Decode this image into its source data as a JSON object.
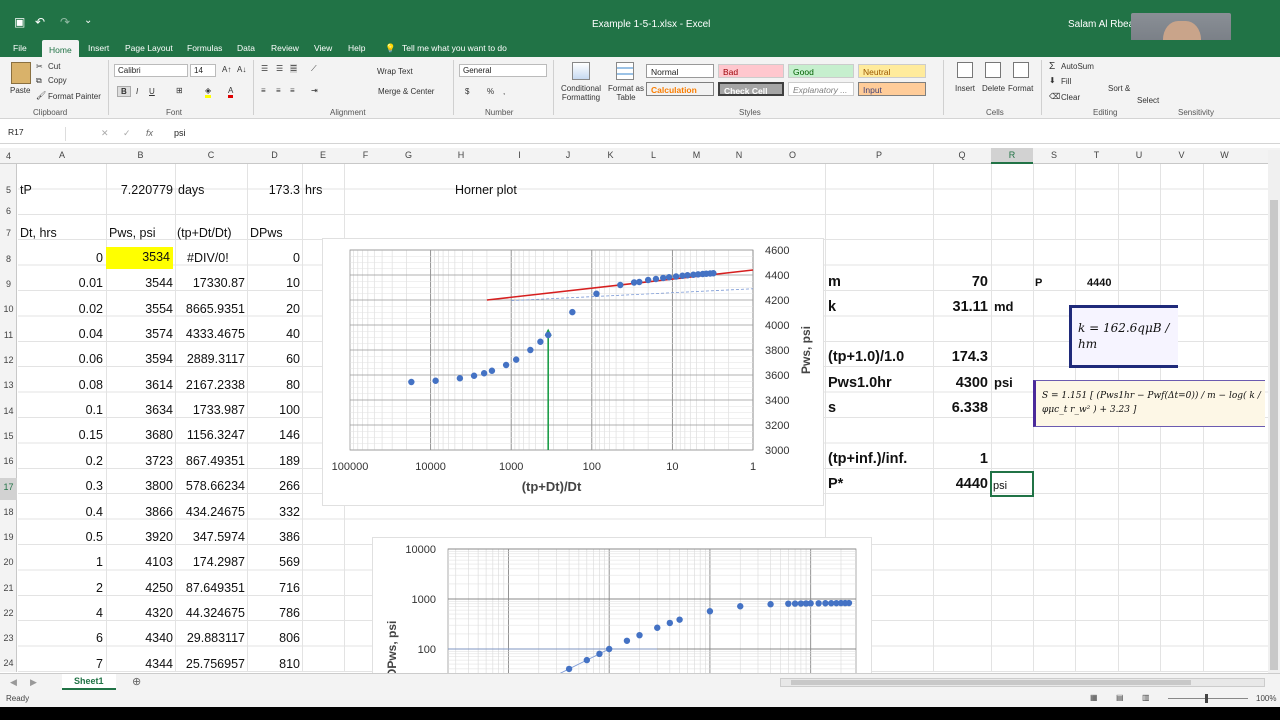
{
  "window": {
    "title": "Example 1-5-1.xlsx  -  Excel",
    "user": "Salam Al Rbeawi"
  },
  "menu": [
    "File",
    "Home",
    "Insert",
    "Page Layout",
    "Formulas",
    "Data",
    "Review",
    "View",
    "Help",
    "Tell me what you want to do"
  ],
  "ribbon": {
    "clipboard": {
      "paste": "Paste",
      "cut": "Cut",
      "copy": "Copy",
      "painter": "Format Painter",
      "label": "Clipboard"
    },
    "font": {
      "name": "Calibri",
      "size": "14",
      "label": "Font",
      "b": "B",
      "i": "I",
      "u": "U"
    },
    "alignment": {
      "wrap": "Wrap Text",
      "merge": "Merge & Center",
      "label": "Alignment"
    },
    "number": {
      "format": "General",
      "label": "Number",
      "currency": "$",
      "percent": "%",
      "comma": ","
    },
    "styles": {
      "cond": "Conditional Formatting",
      "table": "Format as Table",
      "normal": "Normal",
      "bad": "Bad",
      "good": "Good",
      "neutral": "Neutral",
      "calc": "Calculation",
      "check": "Check Cell",
      "expl": "Explanatory ...",
      "input": "Input",
      "label": "Styles"
    },
    "cells": {
      "insert": "Insert",
      "delete": "Delete",
      "format": "Format",
      "label": "Cells"
    },
    "editing": {
      "autosum": "AutoSum",
      "fill": "Fill",
      "clear": "Clear",
      "sort": "Sort & Filter",
      "find": "Select",
      "label": "Editing"
    },
    "sensitivity": "Sensitivity"
  },
  "formula": {
    "namebox": "R17",
    "fx": "fx",
    "content": "psi"
  },
  "columns": [
    "A",
    "B",
    "C",
    "D",
    "E",
    "F",
    "G",
    "H",
    "I",
    "J",
    "K",
    "L",
    "M",
    "N",
    "O",
    "P",
    "Q",
    "R",
    "S",
    "T",
    "U",
    "V",
    "W"
  ],
  "rows": [
    "4",
    "5",
    "6",
    "7",
    "8",
    "9",
    "10",
    "11",
    "12",
    "13",
    "14",
    "15",
    "16",
    "17",
    "18",
    "19",
    "20",
    "21",
    "22",
    "23",
    "24"
  ],
  "cells": {
    "tp_label": "tP",
    "tp_val": "7.220779",
    "tp_days": "days",
    "tp_hrs_val": "173.3",
    "tp_hrs": "hrs",
    "horner_title": "Horner plot",
    "h_dt": "Dt, hrs",
    "h_pws": "Pws, psi",
    "h_ratio": "(tp+Dt/Dt)",
    "h_dpws": "DPws"
  },
  "table": [
    [
      "0",
      "3534",
      "#DIV/0!",
      "0"
    ],
    [
      "0.01",
      "3544",
      "17330.87",
      "10"
    ],
    [
      "0.02",
      "3554",
      "8665.9351",
      "20"
    ],
    [
      "0.04",
      "3574",
      "4333.4675",
      "40"
    ],
    [
      "0.06",
      "3594",
      "2889.3117",
      "60"
    ],
    [
      "0.08",
      "3614",
      "2167.2338",
      "80"
    ],
    [
      "0.1",
      "3634",
      "1733.987",
      "100"
    ],
    [
      "0.15",
      "3680",
      "1156.3247",
      "146"
    ],
    [
      "0.2",
      "3723",
      "867.49351",
      "189"
    ],
    [
      "0.3",
      "3800",
      "578.66234",
      "266"
    ],
    [
      "0.4",
      "3866",
      "434.24675",
      "332"
    ],
    [
      "0.5",
      "3920",
      "347.5974",
      "386"
    ],
    [
      "1",
      "4103",
      "174.2987",
      "569"
    ],
    [
      "2",
      "4250",
      "87.649351",
      "716"
    ],
    [
      "4",
      "4320",
      "44.324675",
      "786"
    ],
    [
      "6",
      "4340",
      "29.883117",
      "806"
    ],
    [
      "7",
      "4344",
      "25.756957",
      "810"
    ]
  ],
  "results": {
    "m_label": "m",
    "m_val": "70",
    "k_label": "k",
    "k_val": "31.11",
    "k_unit": "md",
    "tp1_label": "(tp+1.0)/1.0",
    "tp1_val": "174.3",
    "pws1_label": "Pws1.0hr",
    "pws1_val": "4300",
    "pws1_unit": "psi",
    "s_label": "s",
    "s_val": "6.338",
    "tpinf_label": "(tp+inf.)/inf.",
    "tpinf_val": "1",
    "pstar_label": "P*",
    "pstar_val": "4440",
    "pstar_unit": "psi",
    "p_label": "P",
    "p_val": "4440"
  },
  "equations": {
    "k_eq": "k = 162.6qμB / hm",
    "s_eq": "S = 1.151 [ (Pws1hr − Pwf(Δt=0)) / m − log( k / φμc_t r_w² ) + 3.23 ]"
  },
  "chart_data": [
    {
      "type": "scatter",
      "xlabel": "(tp+Dt)/Dt",
      "ylabel": "Pws, psi",
      "xscale": "log",
      "xreversed": true,
      "xlim": [
        100000,
        1
      ],
      "ylim": [
        3000,
        4600
      ],
      "xticks": [
        "100000",
        "10000",
        "1000",
        "100",
        "10",
        "1"
      ],
      "yticks": [
        "4600",
        "4400",
        "4200",
        "4000",
        "3800",
        "3600",
        "3400",
        "3200",
        "3000"
      ],
      "x": [
        17330.87,
        8665.9351,
        4333.4675,
        2889.3117,
        2167.2338,
        1733.987,
        1156.3247,
        867.49351,
        578.66234,
        434.24675,
        347.5974,
        174.2987,
        87.649351,
        44.324675,
        29.883117,
        25.756957,
        20,
        16,
        13,
        11,
        9,
        7.5,
        6.5,
        5.5,
        4.8,
        4.2,
        3.8,
        3.4,
        3.1
      ],
      "y": [
        3544,
        3554,
        3574,
        3594,
        3614,
        3634,
        3680,
        3723,
        3800,
        3866,
        3920,
        4103,
        4250,
        4320,
        4340,
        4344,
        4360,
        4368,
        4376,
        4382,
        4388,
        4394,
        4398,
        4402,
        4405,
        4408,
        4410,
        4412,
        4414
      ],
      "line": {
        "x": [
          2000,
          1
        ],
        "y": [
          4200,
          4440
        ]
      },
      "vline": {
        "x": 347.6
      }
    },
    {
      "type": "scatter",
      "ylabel": "DPws, psi",
      "yscale": "log",
      "yticks": [
        "10000",
        "1000",
        "100"
      ],
      "xscale": "log",
      "x": [
        0.01,
        0.02,
        0.04,
        0.06,
        0.08,
        0.1,
        0.15,
        0.2,
        0.3,
        0.4,
        0.5,
        1,
        2,
        4,
        6,
        7,
        8,
        9,
        10,
        12,
        14,
        16,
        18,
        20,
        22,
        24
      ],
      "y": [
        10,
        20,
        40,
        60,
        80,
        100,
        146,
        189,
        266,
        332,
        386,
        569,
        716,
        786,
        806,
        810,
        812,
        815,
        818,
        820,
        822,
        824,
        826,
        828,
        829,
        830
      ]
    }
  ]
}
